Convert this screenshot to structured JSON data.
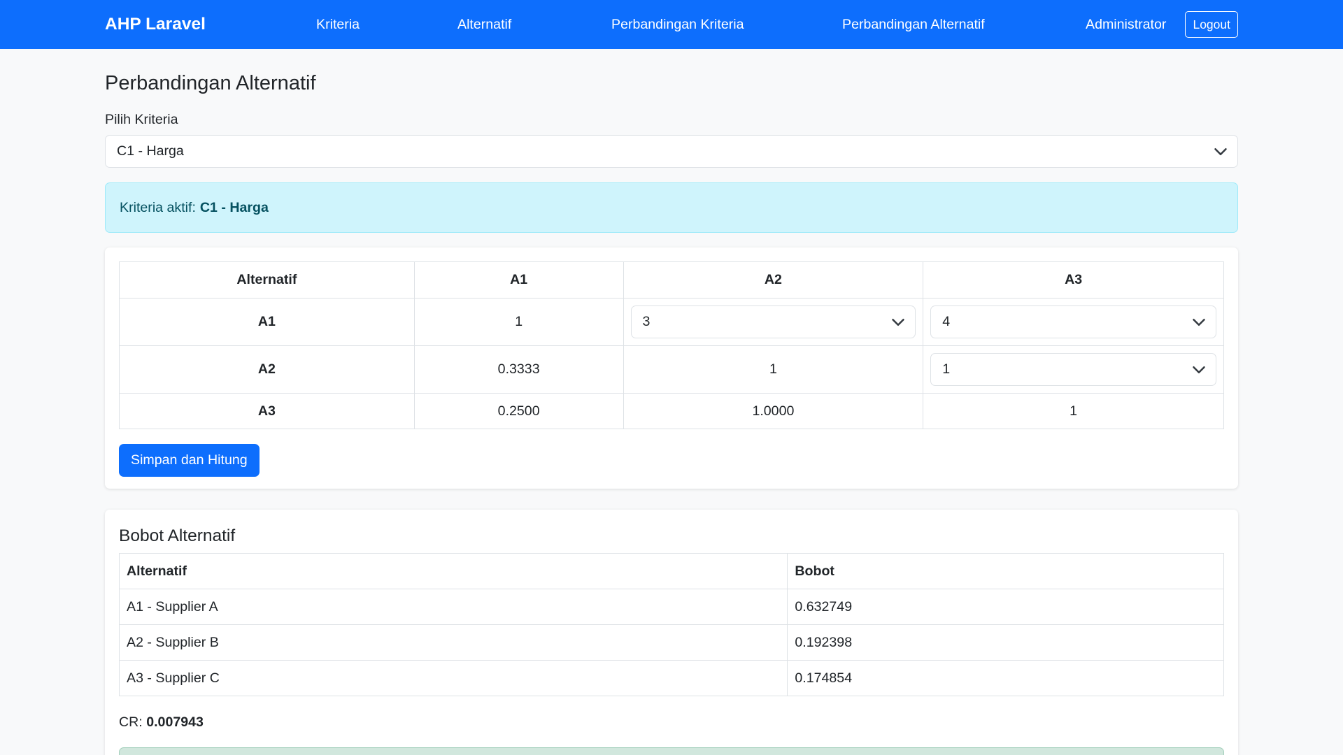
{
  "navbar": {
    "brand": "AHP Laravel",
    "links": [
      "Kriteria",
      "Alternatif",
      "Perbandingan Kriteria",
      "Perbandingan Alternatif"
    ],
    "user": "Administrator",
    "logout_label": "Logout",
    "color": "#0d6efd"
  },
  "page": {
    "title": "Perbandingan Alternatif",
    "select_label": "Pilih Kriteria",
    "selected_criteria": "C1 - Harga",
    "active_prefix": "Kriteria aktif:",
    "active_value": "C1 - Harga"
  },
  "matrix": {
    "header": [
      "Alternatif",
      "A1",
      "A2",
      "A3"
    ],
    "rows": [
      {
        "label": "A1",
        "c1": "1",
        "c2": "3",
        "c3": "4"
      },
      {
        "label": "A2",
        "c1": "0.3333",
        "c2": "1",
        "c3": "1"
      },
      {
        "label": "A3",
        "c1": "0.2500",
        "c2": "1.0000",
        "c3": "1"
      }
    ],
    "submit_label": "Simpan dan Hitung"
  },
  "weights": {
    "title": "Bobot Alternatif",
    "header": [
      "Alternatif",
      "Bobot"
    ],
    "rows": [
      {
        "name": "A1 - Supplier A",
        "value": "0.632749"
      },
      {
        "name": "A2 - Supplier B",
        "value": "0.192398"
      },
      {
        "name": "A3 - Supplier C",
        "value": "0.174854"
      }
    ],
    "cr_label": "CR:",
    "cr_value": "0.007943"
  }
}
